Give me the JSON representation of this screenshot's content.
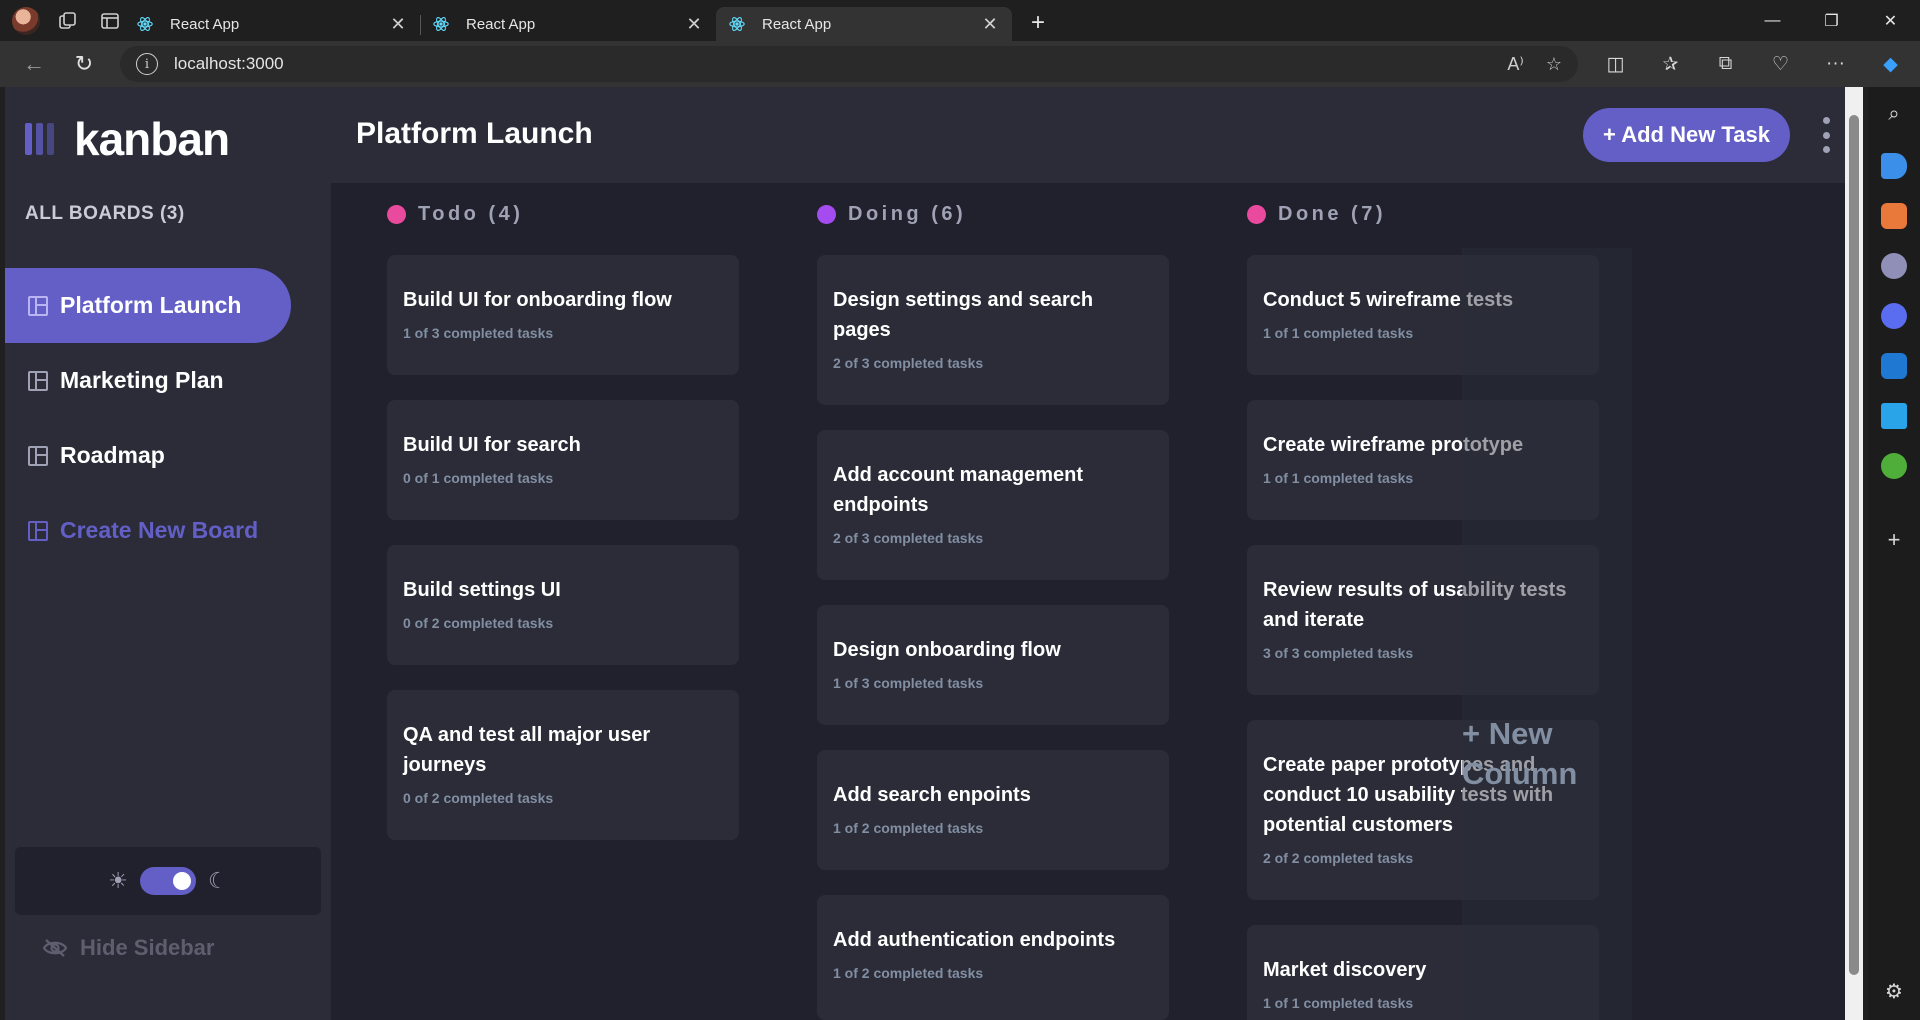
{
  "browser": {
    "tabs": [
      {
        "title": "React App"
      },
      {
        "title": "React App"
      },
      {
        "title": "React App"
      }
    ],
    "url": "localhost:3000"
  },
  "app": {
    "logo": "kanban",
    "all_boards_label": "ALL BOARDS (3)",
    "boards": [
      "Platform Launch",
      "Marketing Plan",
      "Roadmap"
    ],
    "create_board_label": "Create New Board",
    "hide_sidebar_label": "Hide Sidebar",
    "board_title": "Platform Launch",
    "add_task_label": "+ Add New Task",
    "new_column_label": "+ New Column",
    "accent_color": "#635fc7",
    "columns": [
      {
        "name": "Todo (4)",
        "color": "#e94a9d",
        "tasks": [
          {
            "title": "Build UI for onboarding flow",
            "subtasks": "1 of 3 completed tasks"
          },
          {
            "title": "Build UI for search",
            "subtasks": "0 of 1 completed tasks"
          },
          {
            "title": "Build settings UI",
            "subtasks": "0 of 2 completed tasks"
          },
          {
            "title": "QA and test all major user journeys",
            "subtasks": "0 of 2 completed tasks"
          }
        ]
      },
      {
        "name": "Doing (6)",
        "color": "#a54cf0",
        "tasks": [
          {
            "title": "Design settings and search pages",
            "subtasks": "2 of 3 completed tasks"
          },
          {
            "title": "Add account management endpoints",
            "subtasks": "2 of 3 completed tasks"
          },
          {
            "title": "Design onboarding flow",
            "subtasks": "1 of 3 completed tasks"
          },
          {
            "title": "Add search enpoints",
            "subtasks": "1 of 2 completed tasks"
          },
          {
            "title": "Add authentication endpoints",
            "subtasks": "1 of 2 completed tasks"
          }
        ]
      },
      {
        "name": "Done (7)",
        "color": "#e94a9d",
        "tasks": [
          {
            "title": "Conduct 5 wireframe tests",
            "subtasks": "1 of 1 completed tasks"
          },
          {
            "title": "Create wireframe prototype",
            "subtasks": "1 of 1 completed tasks"
          },
          {
            "title": "Review results of usability tests and iterate",
            "subtasks": "3 of 3 completed tasks"
          },
          {
            "title": "Create paper prototypes and conduct 10 usability tests with potential customers",
            "subtasks": "2 of 2 completed tasks"
          },
          {
            "title": "Market discovery",
            "subtasks": "1 of 1 completed tasks"
          }
        ]
      }
    ]
  }
}
